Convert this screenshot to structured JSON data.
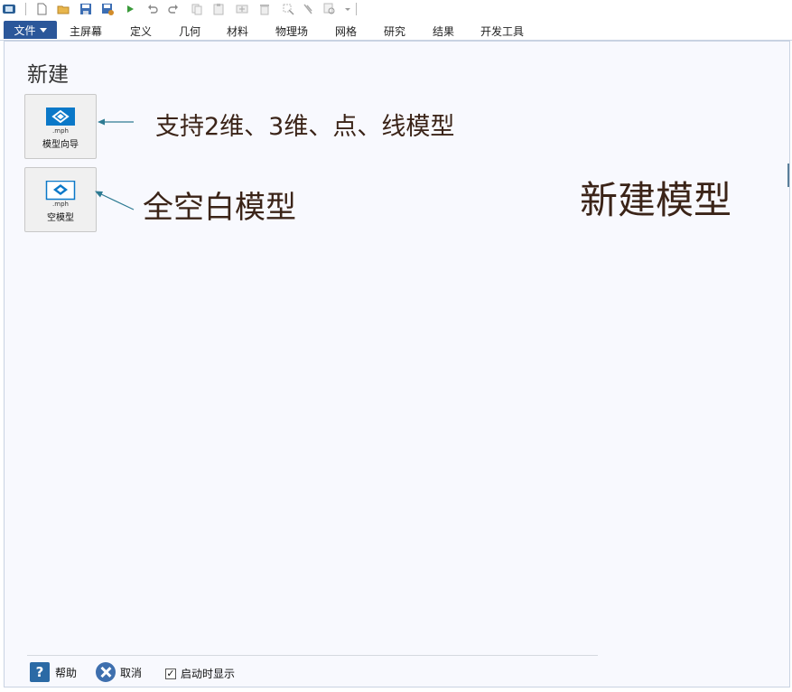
{
  "toolbar": {
    "icons": [
      "app-icon",
      "new-file-icon",
      "open-folder-icon",
      "save-icon",
      "save-as-icon",
      "run-icon",
      "undo-icon",
      "redo-icon",
      "copy-icon",
      "paste-icon",
      "duplicate-icon",
      "delete-icon",
      "clear-selection-icon",
      "clean-icon",
      "find-icon",
      "dropdown-icon"
    ]
  },
  "ribbon": {
    "file_label": "文件",
    "tabs": [
      "主屏幕",
      "定义",
      "几何",
      "材料",
      "物理场",
      "网格",
      "研究",
      "结果",
      "开发工具"
    ]
  },
  "page": {
    "title": "新建",
    "tiles": [
      {
        "ext": ".mph",
        "label": "模型向导"
      },
      {
        "ext": ".mph",
        "label": "空模型"
      }
    ]
  },
  "annotations": {
    "wizard_note": "支持2维、3维、点、线模型",
    "blank_note": "全空白模型",
    "side_note": "新建模型"
  },
  "footer": {
    "help_label": "帮助",
    "cancel_label": "取消",
    "show_on_startup_label": "启动时显示",
    "show_on_startup_checked": true
  },
  "colors": {
    "accent": "#2b579a",
    "tile_icon": "#0a78c8",
    "annotation_text": "#3b2418",
    "arrow": "#2e7b93",
    "panel_bg": "#f8f9fe"
  }
}
